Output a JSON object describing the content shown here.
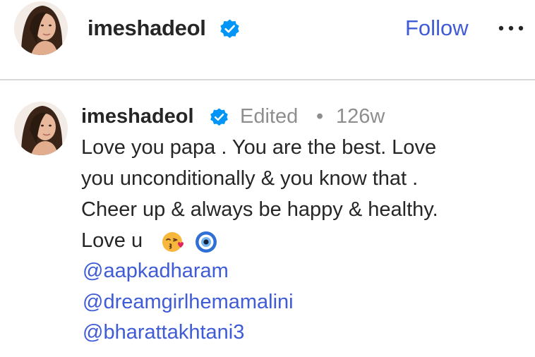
{
  "header": {
    "username": "imeshadeol",
    "follow_label": "Follow",
    "more_icon": "more-horizontal-icon",
    "verified_icon": "verified-badge-icon"
  },
  "comment": {
    "username": "imeshadeol",
    "verified_icon": "verified-badge-icon",
    "edited_label": "Edited",
    "separator": "•",
    "time": "126w",
    "lines": [
      "Love you papa . You are the best. Love",
      "you unconditionally & you know that .",
      "Cheer up & always be happy & healthy.",
      "Love u"
    ],
    "emojis": [
      "face-blowing-kiss-emoji",
      "nazar-amulet-emoji"
    ],
    "mentions": [
      "@aapkadharam",
      "@dreamgirlhemamalini",
      "@bharattakhtani3"
    ]
  },
  "colors": {
    "link": "#3f5bd6",
    "verified": "#0095f6",
    "muted": "#8e8e8e",
    "text": "#262626",
    "divider": "#d9d9d9"
  }
}
